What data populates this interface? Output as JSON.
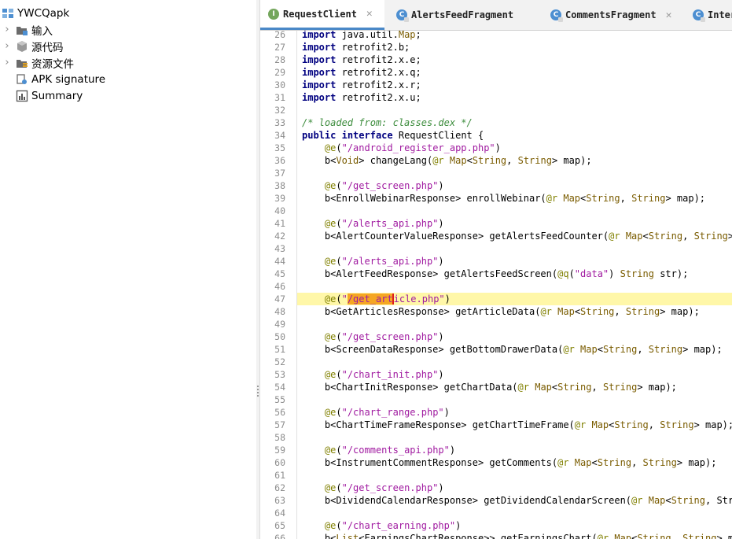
{
  "tree": {
    "root_label": "YWCQapk",
    "items": [
      {
        "label": "输入",
        "expandable": true,
        "icon": "package-icon"
      },
      {
        "label": "源代码",
        "expandable": true,
        "icon": "source-code-icon"
      },
      {
        "label": "资源文件",
        "expandable": true,
        "icon": "resources-icon"
      },
      {
        "label": "APK signature",
        "expandable": false,
        "icon": "certificate-icon"
      },
      {
        "label": "Summary",
        "expandable": false,
        "icon": "summary-chart-icon"
      }
    ]
  },
  "tabs": [
    {
      "label": "RequestClient",
      "kind": "I",
      "active": true
    },
    {
      "label": "AlertsFeedFragment",
      "kind": "C",
      "active": false
    },
    {
      "label": "CommentsFragment",
      "kind": "C",
      "active": false
    },
    {
      "label": "Inter",
      "kind": "C",
      "active": false
    }
  ],
  "editor": {
    "highlight_line": 47,
    "lines": [
      {
        "n": "26",
        "code": "import java.util.Map;"
      },
      {
        "n": "27",
        "code": "import retrofit2.b;"
      },
      {
        "n": "28",
        "code": "import retrofit2.x.e;"
      },
      {
        "n": "29",
        "code": "import retrofit2.x.q;"
      },
      {
        "n": "30",
        "code": "import retrofit2.x.r;"
      },
      {
        "n": "31",
        "code": "import retrofit2.x.u;"
      },
      {
        "n": "32",
        "code": ""
      },
      {
        "n": "33",
        "code": "/* loaded from: classes.dex */"
      },
      {
        "n": "34",
        "code": "public interface RequestClient {"
      },
      {
        "n": "35",
        "code": "    @e(\"/android_register_app.php\")"
      },
      {
        "n": "36",
        "code": "    b<Void> changeLang(@r Map<String, String> map);"
      },
      {
        "n": "37",
        "code": ""
      },
      {
        "n": "38",
        "code": "    @e(\"/get_screen.php\")"
      },
      {
        "n": "39",
        "code": "    b<EnrollWebinarResponse> enrollWebinar(@r Map<String, String> map);"
      },
      {
        "n": "40",
        "code": ""
      },
      {
        "n": "41",
        "code": "    @e(\"/alerts_api.php\")"
      },
      {
        "n": "42",
        "code": "    b<AlertCounterValueResponse> getAlertsFeedCounter(@r Map<String, String> m"
      },
      {
        "n": "43",
        "code": ""
      },
      {
        "n": "44",
        "code": "    @e(\"/alerts_api.php\")"
      },
      {
        "n": "45",
        "code": "    b<AlertFeedResponse> getAlertsFeedScreen(@q(\"data\") String str);"
      },
      {
        "n": "46",
        "code": ""
      },
      {
        "n": "47",
        "code": "    @e(\"/get_article.php\")"
      },
      {
        "n": "48",
        "code": "    b<GetArticlesResponse> getArticleData(@r Map<String, String> map);"
      },
      {
        "n": "49",
        "code": ""
      },
      {
        "n": "50",
        "code": "    @e(\"/get_screen.php\")"
      },
      {
        "n": "51",
        "code": "    b<ScreenDataResponse> getBottomDrawerData(@r Map<String, String> map);"
      },
      {
        "n": "52",
        "code": ""
      },
      {
        "n": "53",
        "code": "    @e(\"/chart_init.php\")"
      },
      {
        "n": "54",
        "code": "    b<ChartInitResponse> getChartData(@r Map<String, String> map);"
      },
      {
        "n": "55",
        "code": ""
      },
      {
        "n": "56",
        "code": "    @e(\"/chart_range.php\")"
      },
      {
        "n": "57",
        "code": "    b<ChartTimeFrameResponse> getChartTimeFrame(@r Map<String, String> map);"
      },
      {
        "n": "58",
        "code": ""
      },
      {
        "n": "59",
        "code": "    @e(\"/comments_api.php\")"
      },
      {
        "n": "60",
        "code": "    b<InstrumentCommentResponse> getComments(@r Map<String, String> map);"
      },
      {
        "n": "61",
        "code": ""
      },
      {
        "n": "62",
        "code": "    @e(\"/get_screen.php\")"
      },
      {
        "n": "63",
        "code": "    b<DividendCalendarResponse> getDividendCalendarScreen(@r Map<String, Strin"
      },
      {
        "n": "64",
        "code": ""
      },
      {
        "n": "65",
        "code": "    @e(\"/chart_earning.php\")"
      },
      {
        "n": "66",
        "code": "    b<List<EarningsChartResponse>> getEarningsChart(@r Map<String, String> map"
      }
    ]
  },
  "colors": {
    "keyword": "#000080",
    "string": "#a01aa0",
    "annotation": "#808000",
    "comment": "#3c8c3c",
    "line_highlight": "#fff7a8",
    "selection": "#f5a623",
    "tab_underline": "#4a88c7"
  }
}
